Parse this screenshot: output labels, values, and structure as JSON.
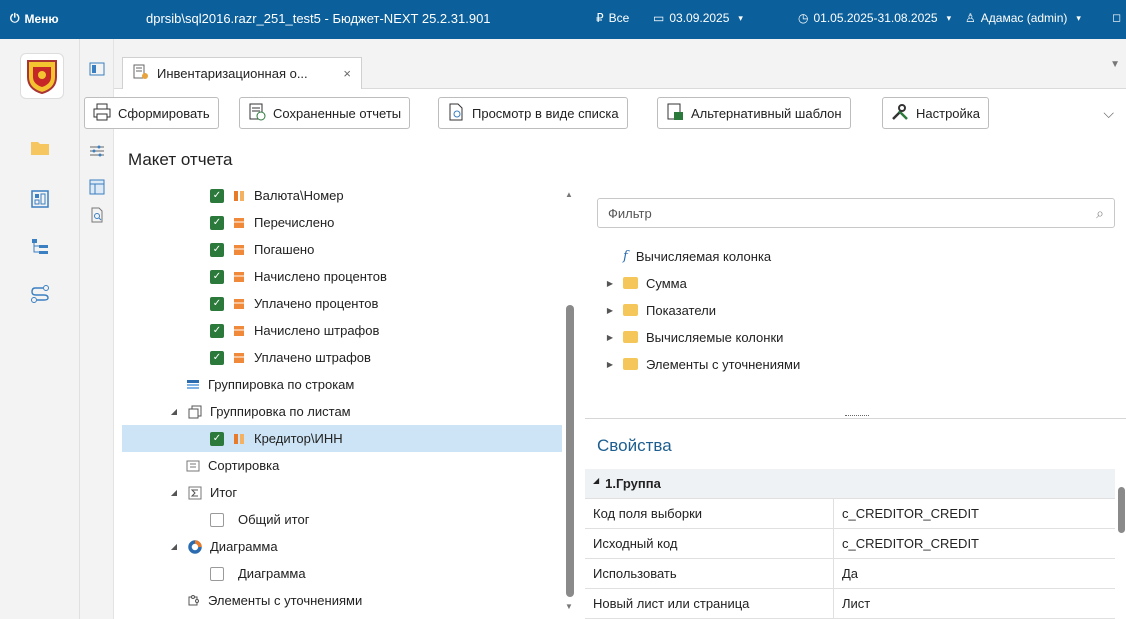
{
  "titlebar": {
    "menu_label": "Меню",
    "app_title": "dprsib\\sql2016.razr_251_test5 - Бюджет-NEXT 25.2.31.901",
    "currency_label": "Все",
    "date_label": "03.09.2025",
    "period_label": "01.05.2025-31.08.2025",
    "user_label": "Адамас (admin)"
  },
  "tab": {
    "label": "Инвентаризационная о...",
    "close": "×"
  },
  "toolbar": {
    "generate": "Сформировать",
    "saved_reports": "Сохраненные отчеты",
    "list_view": "Просмотр в виде списка",
    "alt_template": "Альтернативный шаблон",
    "settings": "Настройка"
  },
  "section_title": "Макет отчета",
  "tree": [
    {
      "label": "Валюта\\Номер",
      "checked": true
    },
    {
      "label": "Перечислено",
      "checked": true
    },
    {
      "label": "Погашено",
      "checked": true
    },
    {
      "label": "Начислено процентов",
      "checked": true
    },
    {
      "label": "Уплачено процентов",
      "checked": true
    },
    {
      "label": "Начислено штрафов",
      "checked": true
    },
    {
      "label": "Уплачено штрафов",
      "checked": true
    },
    {
      "label": "Группировка по строкам"
    },
    {
      "label": "Группировка по листам"
    },
    {
      "label": "Кредитор\\ИНН",
      "checked": true
    },
    {
      "label": "Сортировка"
    },
    {
      "label": "Итог"
    },
    {
      "label": "Общий итог",
      "checked": false
    },
    {
      "label": "Диаграмма"
    },
    {
      "label": "Диаграмма",
      "checked": false
    },
    {
      "label": "Элементы с уточнениями"
    }
  ],
  "filter": {
    "placeholder": "Фильтр"
  },
  "fields": {
    "calc_column": "Вычисляемая колонка",
    "folders": [
      "Сумма",
      "Показатели",
      "Вычисляемые колонки",
      "Элементы с уточнениями"
    ]
  },
  "properties": {
    "title": "Свойства",
    "group": "1.Группа",
    "rows": [
      {
        "key": "Код поля выборки",
        "value": "c_CREDITOR_CREDIT"
      },
      {
        "key": "Исходный код",
        "value": "c_CREDITOR_CREDIT"
      },
      {
        "key": "Использовать",
        "value": "Да"
      },
      {
        "key": "Новый лист или страница",
        "value": "Лист"
      }
    ]
  }
}
